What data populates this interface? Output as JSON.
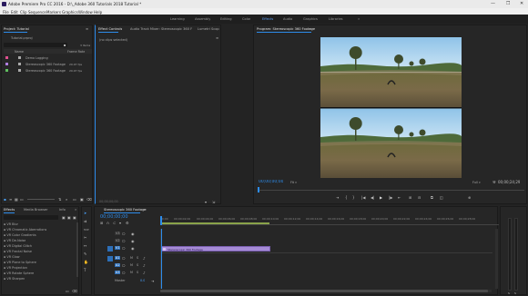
{
  "window": {
    "title": "Adobe Premiere Pro CC 2016 - D:\\_Adobe 360 Tutorials 2018 Tutorial *",
    "controls": [
      "—",
      "❐",
      "✕"
    ]
  },
  "menu": [
    "File",
    "Edit",
    "Clip",
    "Sequence",
    "Markers",
    "Graphics",
    "Window",
    "Help"
  ],
  "workspaces": {
    "items": [
      "Learning",
      "Assembly",
      "Editing",
      "Color",
      "Effects",
      "Audio",
      "Graphics",
      "Libraries"
    ],
    "active": "Effects",
    "more": "»"
  },
  "project_panel": {
    "tab": "Project: Tutorial",
    "menu_icon": "≡",
    "file": "Tutorial.prproj",
    "item_count": "3 Items",
    "columns": [
      "Name",
      "Frame Rate"
    ],
    "items": [
      {
        "name": "Demo Logging",
        "rate": "",
        "color": "#e05090"
      },
      {
        "name": "Stereoscopic 360 Footage",
        "rate": "29.97 fps",
        "color": "#b07ee0"
      },
      {
        "name": "Stereoscopic 360 Footage",
        "rate": "29.97 fps",
        "color": "#5fbf5f"
      }
    ]
  },
  "effect_controls": {
    "tabs": [
      "Effect Controls",
      "Audio Track Mixer: Stereoscopic 360 Footage",
      "Lumetri Scopes"
    ],
    "menu_icon": "≡",
    "message": "(no clips selected)",
    "footer_tc": "00;00;00;00"
  },
  "program_monitor": {
    "tab": "Program: Stereoscopic 360 Footage",
    "menu_icon": "≡",
    "timecode": "00;00;00;00",
    "fit": "Fit",
    "resolution": "Full",
    "duration": "00;00;24;29",
    "transport": [
      "⇥",
      "{",
      "}",
      "|◀",
      "◀|",
      "▶",
      "|▶",
      "⇤",
      "⊞",
      "⊟",
      "⧉",
      "◫",
      "⊕"
    ]
  },
  "effects_panel": {
    "tabs": [
      "Effects",
      "Media Browser",
      "Info"
    ],
    "menu_icon": "»",
    "search_placeholder": "",
    "items": [
      "VR Blur",
      "VR Chromatic Aberrations",
      "VR Color Gradients",
      "VR De-Noise",
      "VR Digital Glitch",
      "VR Fractal Noise",
      "VR Glow",
      "VR Plane to Sphere",
      "VR Projection",
      "VR Rotate Sphere",
      "VR Sharpen"
    ]
  },
  "timeline": {
    "tab": "Stereoscopic 360 Footage",
    "menu_icon": "≡",
    "timecode": "00;00;00;00",
    "ruler": [
      "00;00",
      "00;00;02;00",
      "00;00;04;00",
      "00;00;06;00",
      "00;00;08;00",
      "00;00;10;00",
      "00;00;12;00",
      "00;00;14;00",
      "00;00;16;00",
      "00;00;18;00",
      "00;00;20;00",
      "00;00;22;00",
      "00;00;24;00",
      "00;00;26;00",
      "00;00;28;00"
    ],
    "video_tracks": [
      "V3",
      "V2",
      "V1"
    ],
    "audio_tracks": [
      "A1",
      "A2",
      "A3"
    ],
    "master": "Master",
    "master_value": "0.0",
    "clip_label": "Stereoscopic 360 Footage"
  }
}
